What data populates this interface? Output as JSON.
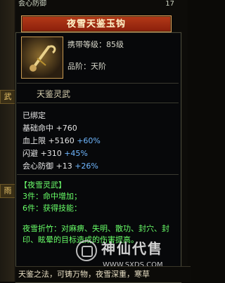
{
  "top_hint": {
    "label": "会心防御",
    "value": "17"
  },
  "title": "夜雪天鉴玉钩",
  "item": {
    "level_label": "携带等级：85级",
    "quality_label": "品阶：天阶"
  },
  "section_title": "天鉴灵武",
  "sidebar": {
    "tab_label": "武",
    "tab2_label": "雨"
  },
  "stats": {
    "bound": "已绑定",
    "lines": [
      {
        "name": "基础命中",
        "base": "+760",
        "extra": ""
      },
      {
        "name": "血上限",
        "base": "+5160",
        "extra": "+60%"
      },
      {
        "name": "闪避",
        "base": "+310",
        "extra": "+45%"
      },
      {
        "name": "会心防御",
        "base": "+13",
        "extra": "+26%"
      }
    ]
  },
  "set": {
    "title": "【夜雪灵武】",
    "line3": "3件：命中增加；",
    "line6": "6件：获得技能：",
    "desc": "夜雪折竹：对麻痹、失明、散功、封穴、封印、眩晕的目标造成的伤害提高。"
  },
  "footer_text": "天鉴之法，可铸万物，夜雪深重，寒草",
  "watermark": {
    "brand": "神仙代售",
    "url": "WWW.SXDS.COM"
  },
  "colors": {
    "stat_white": "#e6e6e6",
    "stat_blue": "#6fb7ff",
    "set_green": "#4cff4c"
  }
}
